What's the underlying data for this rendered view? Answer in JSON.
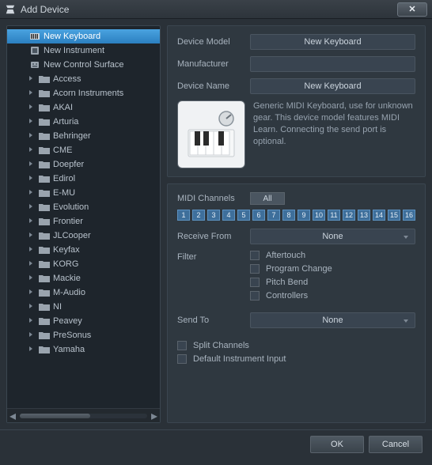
{
  "window": {
    "title": "Add Device"
  },
  "sidebar": {
    "top_items": [
      {
        "label": "New Keyboard",
        "selected": true,
        "icon": "keyboard"
      },
      {
        "label": "New Instrument",
        "selected": false,
        "icon": "instrument"
      },
      {
        "label": "New Control Surface",
        "selected": false,
        "icon": "surface"
      }
    ],
    "folders": [
      "Access",
      "Acorn Instruments",
      "AKAI",
      "Arturia",
      "Behringer",
      "CME",
      "Doepfer",
      "Edirol",
      "E-MU",
      "Evolution",
      "Frontier",
      "JLCooper",
      "Keyfax",
      "KORG",
      "Mackie",
      "M-Audio",
      "NI",
      "Peavey",
      "PreSonus",
      "Yamaha"
    ]
  },
  "details": {
    "device_model_label": "Device Model",
    "device_model_value": "New Keyboard",
    "manufacturer_label": "Manufacturer",
    "manufacturer_value": "",
    "device_name_label": "Device Name",
    "device_name_value": "New Keyboard",
    "description": "Generic MIDI Keyboard, use for unknown gear. This device model features MIDI Learn. Connecting the send port is optional."
  },
  "midi": {
    "channels_label": "MIDI Channels",
    "all_label": "All",
    "channels": [
      "1",
      "2",
      "3",
      "4",
      "5",
      "6",
      "7",
      "8",
      "9",
      "10",
      "11",
      "12",
      "13",
      "14",
      "15",
      "16"
    ],
    "receive_label": "Receive From",
    "receive_value": "None",
    "filter_label": "Filter",
    "filter_options": [
      "Aftertouch",
      "Program Change",
      "Pitch Bend",
      "Controllers"
    ],
    "send_label": "Send To",
    "send_value": "None",
    "split_label": "Split Channels",
    "default_label": "Default Instrument Input"
  },
  "footer": {
    "ok": "OK",
    "cancel": "Cancel"
  }
}
